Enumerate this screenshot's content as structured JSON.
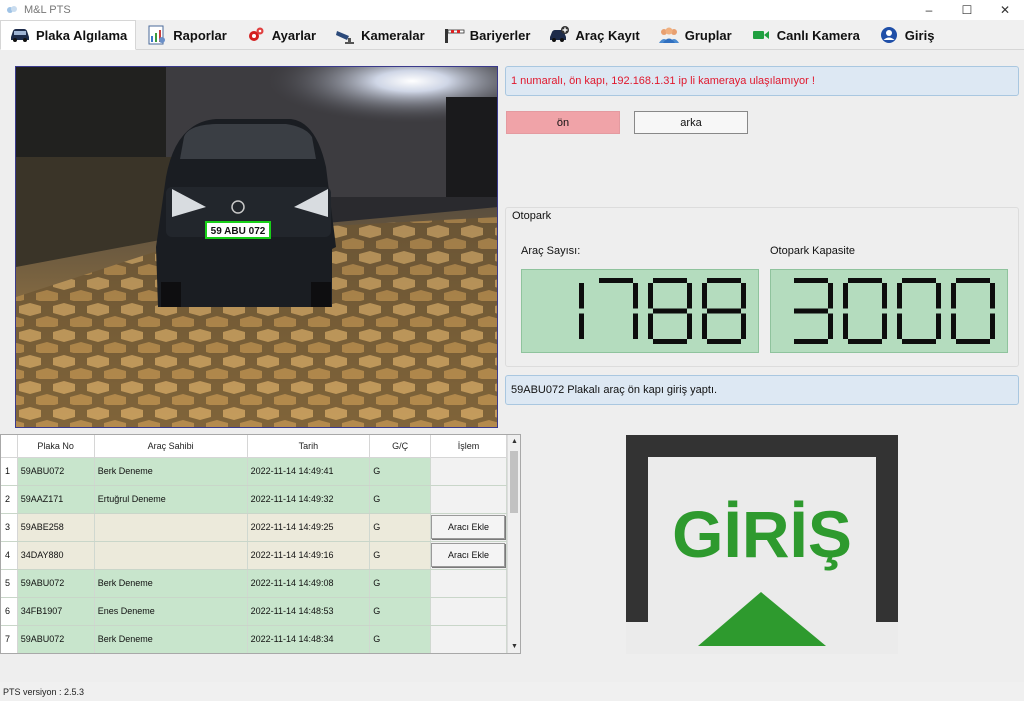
{
  "window": {
    "title": "M&L PTS"
  },
  "tabs": [
    {
      "label": "Plaka Algılama",
      "icon": "car-icon",
      "active": true
    },
    {
      "label": "Raporlar",
      "icon": "report-icon",
      "active": false
    },
    {
      "label": "Ayarlar",
      "icon": "gears-icon",
      "active": false
    },
    {
      "label": "Kameralar",
      "icon": "camera-icon",
      "active": false
    },
    {
      "label": "Bariyerler",
      "icon": "barrier-icon",
      "active": false
    },
    {
      "label": "Araç Kayıt",
      "icon": "car-add-icon",
      "active": false
    },
    {
      "label": "Gruplar",
      "icon": "group-icon",
      "active": false
    },
    {
      "label": "Canlı Kamera",
      "icon": "video-icon",
      "active": false
    },
    {
      "label": "Giriş",
      "icon": "user-icon",
      "active": false
    }
  ],
  "camera": {
    "plate_text": "59 ABU 072"
  },
  "messages": {
    "error": "1 numaralı, ön kapı, 192.168.1.31 ip li kameraya ulaşılamıyor !",
    "event": "59ABU072 Plakalı araç ön kapı giriş yaptı."
  },
  "direction_buttons": {
    "front": "ön",
    "back": "arka"
  },
  "otopark": {
    "title": "Otopark",
    "count_label": "Araç Sayısı:",
    "capacity_label": "Otopark Kapasite",
    "count": "1788",
    "capacity": "3000"
  },
  "table": {
    "headers": [
      "Plaka No",
      "Araç Sahibi",
      "Tarih",
      "G/Ç",
      "İşlem"
    ],
    "rows": [
      {
        "n": "1",
        "plate": "59ABU072",
        "owner": "Berk Deneme",
        "date": "2022-11-14 14:49:41",
        "dir": "G",
        "action": ""
      },
      {
        "n": "2",
        "plate": "59AAZ171",
        "owner": "Ertuğrul Deneme",
        "date": "2022-11-14 14:49:32",
        "dir": "G",
        "action": ""
      },
      {
        "n": "3",
        "plate": "59ABE258",
        "owner": "",
        "date": "2022-11-14 14:49:25",
        "dir": "G",
        "action": "Aracı Ekle"
      },
      {
        "n": "4",
        "plate": "34DAY880",
        "owner": "",
        "date": "2022-11-14 14:49:16",
        "dir": "G",
        "action": "Aracı Ekle"
      },
      {
        "n": "5",
        "plate": "59ABU072",
        "owner": "Berk Deneme",
        "date": "2022-11-14 14:49:08",
        "dir": "G",
        "action": ""
      },
      {
        "n": "6",
        "plate": "34FB1907",
        "owner": "Enes Deneme",
        "date": "2022-11-14 14:48:53",
        "dir": "G",
        "action": ""
      },
      {
        "n": "7",
        "plate": "59ABU072",
        "owner": "Berk Deneme",
        "date": "2022-11-14 14:48:34",
        "dir": "G",
        "action": ""
      }
    ]
  },
  "sign": {
    "text": "GİRİŞ"
  },
  "status": {
    "version": "PTS versiyon : 2.5.3"
  },
  "colors": {
    "green_row": "#c8e5cc",
    "beige_row": "#eceadb",
    "error_text": "#e0182d",
    "counter_bg": "#b4dcbe",
    "sign_green": "#2e9a2e",
    "active_direction": "#f0a3a8"
  }
}
